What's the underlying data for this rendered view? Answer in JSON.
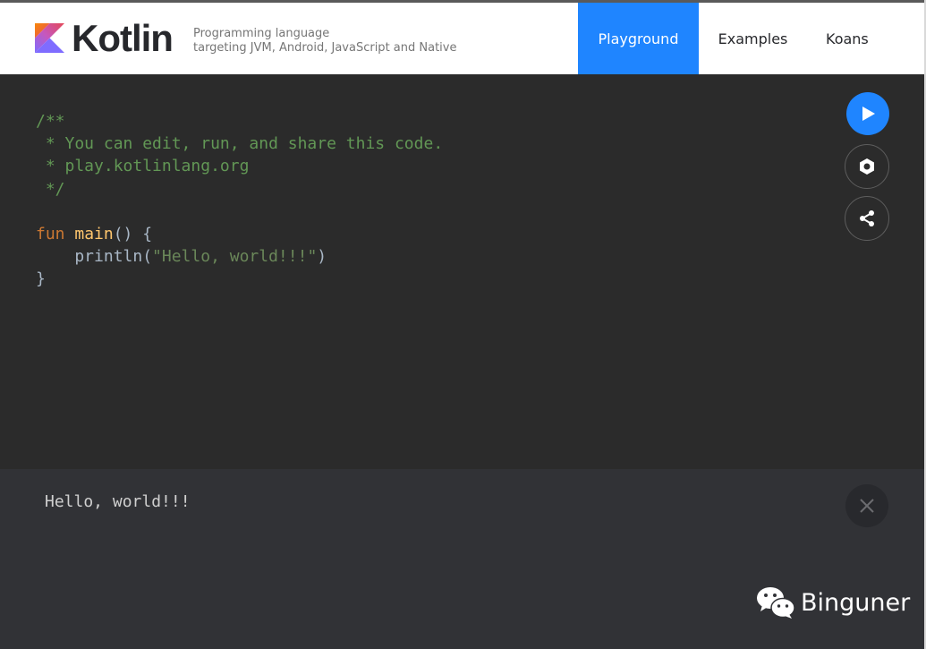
{
  "header": {
    "logo_text": "Kotlin",
    "tagline_line1": "Programming language",
    "tagline_line2": "targeting JVM, Android, JavaScript and Native",
    "nav": {
      "playground": "Playground",
      "examples": "Examples",
      "koans": "Koans",
      "active": "Playground"
    }
  },
  "editor": {
    "lines": [
      [
        {
          "t": "/**",
          "c": "comment"
        }
      ],
      [
        {
          "t": " * You can edit, run, and share this code.",
          "c": "comment"
        }
      ],
      [
        {
          "t": " * play.kotlinlang.org",
          "c": "comment"
        }
      ],
      [
        {
          "t": " */",
          "c": "comment"
        }
      ],
      [
        {
          "t": "",
          "c": "plain"
        }
      ],
      [
        {
          "t": "fun",
          "c": "kw"
        },
        {
          "t": " ",
          "c": "plain"
        },
        {
          "t": "main",
          "c": "fn"
        },
        {
          "t": "() {",
          "c": "plain"
        }
      ],
      [
        {
          "t": "    println(",
          "c": "plain"
        },
        {
          "t": "\"Hello, world!!!\"",
          "c": "str"
        },
        {
          "t": ")",
          "c": "plain"
        }
      ],
      [
        {
          "t": "}",
          "c": "plain"
        }
      ]
    ],
    "actions": {
      "run_icon": "play-icon",
      "settings_icon": "hexagon-settings-icon",
      "share_icon": "share-icon"
    }
  },
  "output": {
    "text": "Hello, world!!!",
    "close_icon": "close-icon"
  },
  "watermark": {
    "text": "Binguner",
    "icon": "wechat-icon"
  },
  "colors": {
    "accent": "#1f85ff",
    "editor_bg": "#2b2b2b",
    "output_bg": "#313236",
    "comment": "#629755",
    "keyword": "#cc7832",
    "function": "#ffc66d",
    "string": "#6a8759"
  }
}
